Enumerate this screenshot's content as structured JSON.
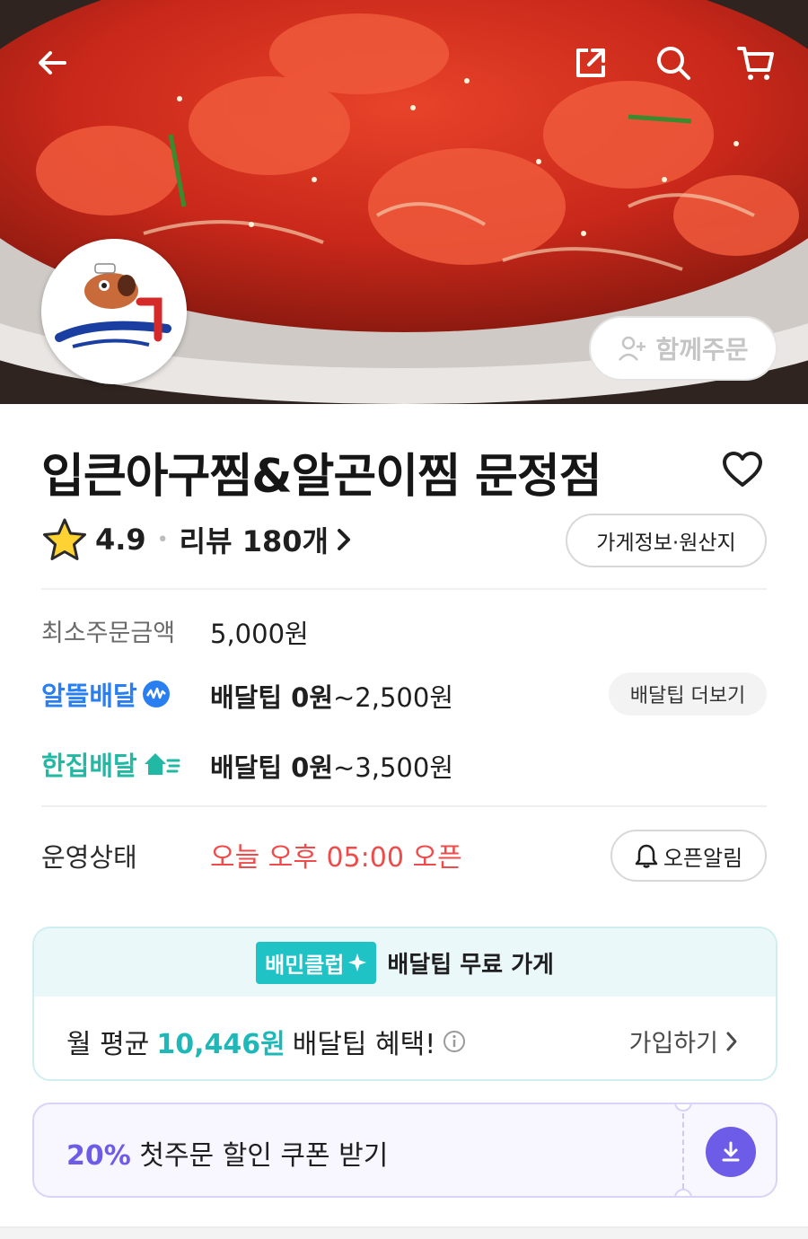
{
  "hero": {
    "group_order_label": "함께주문",
    "icons": {
      "back": "arrow-left-icon",
      "share": "share-icon",
      "search": "search-icon",
      "cart": "cart-icon"
    }
  },
  "store": {
    "name": "입큰아구찜&알곤이찜 문정점",
    "rating": "4.9",
    "review_label": "리뷰 180개",
    "info_button": "가게정보·원산지"
  },
  "details": {
    "min_order_label": "최소주문금액",
    "min_order_value": "5,000원",
    "delivery_options": [
      {
        "type": "알뜰배달",
        "tip_bold": "배달팁 0원",
        "tip_rest": "~2,500원"
      },
      {
        "type": "한집배달",
        "tip_bold": "배달팁 0원",
        "tip_rest": "~3,500원"
      }
    ],
    "tip_more_button": "배달팁 더보기",
    "status_label": "운영상태",
    "status_value": "오늘 오후 05:00 오픈",
    "open_alarm_button": "오픈알림"
  },
  "club": {
    "badge": "배민클럽",
    "free_label": "배달팁 무료 가게",
    "benefit_prefix": "월 평균",
    "benefit_amount": "10,446원",
    "benefit_suffix": "배달팁 혜택!",
    "join_label": "가입하기"
  },
  "coupon": {
    "percent": "20%",
    "text": "첫주문 할인 쿠폰 받기"
  },
  "colors": {
    "blue": "#2a7ff0",
    "teal": "#22b8a4",
    "status_red": "#ef4b4b",
    "club_teal": "#1fc3c6",
    "coupon_purple": "#6d5ce8"
  }
}
